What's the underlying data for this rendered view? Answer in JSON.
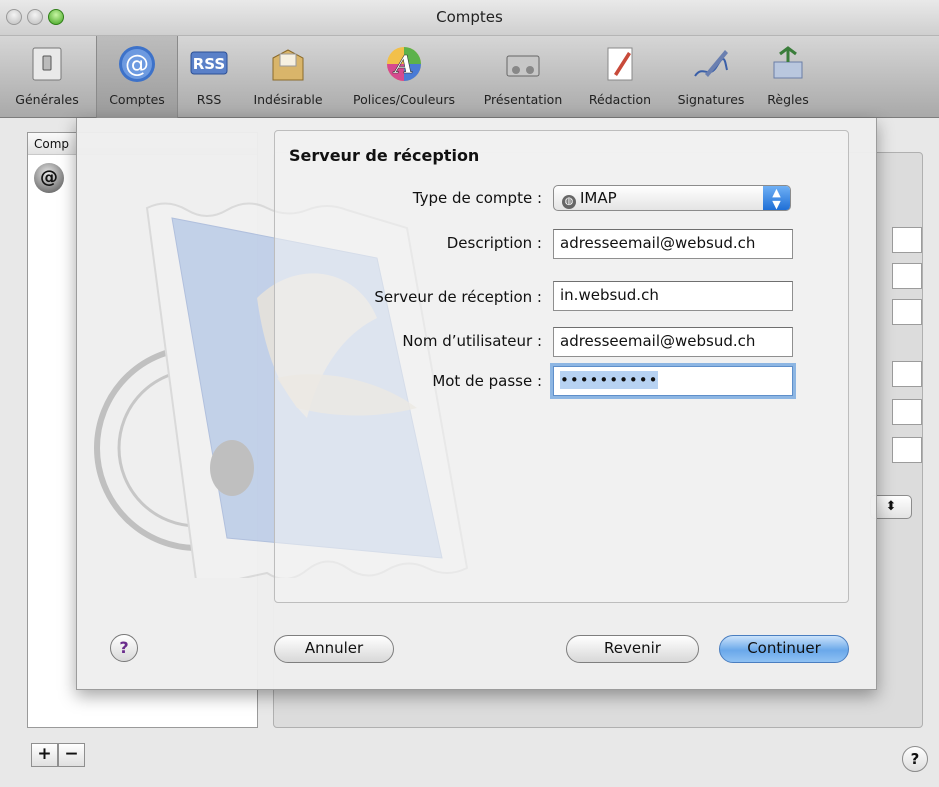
{
  "window": {
    "title": "Comptes"
  },
  "toolbar": {
    "items": [
      {
        "label": "Générales",
        "icon": "switch-icon"
      },
      {
        "label": "Comptes",
        "icon": "at-icon"
      },
      {
        "label": "RSS",
        "icon": "rss-icon"
      },
      {
        "label": "Indésirable",
        "icon": "junk-icon"
      },
      {
        "label": "Polices/Couleurs",
        "icon": "fonts-colors-icon"
      },
      {
        "label": "Présentation",
        "icon": "viewing-icon"
      },
      {
        "label": "Rédaction",
        "icon": "composing-icon"
      },
      {
        "label": "Signatures",
        "icon": "signatures-icon"
      },
      {
        "label": "Règles",
        "icon": "rules-icon"
      }
    ],
    "rss_badge": "RSS",
    "at_glyph": "@",
    "a_glyph": "A"
  },
  "accounts_list": {
    "header": "Comp",
    "icon_glyph": "@"
  },
  "sheet": {
    "title": "Serveur de réception",
    "account_type_label": "Type de compte :",
    "account_type_value": "IMAP",
    "description_label": "Description :",
    "description_value": "adresseemail@websud.ch",
    "incoming_server_label": "Serveur de réception :",
    "incoming_server_value": "in.websud.ch",
    "username_label": "Nom d’utilisateur :",
    "username_value": "adresseemail@websud.ch",
    "password_label": "Mot de passe :",
    "password_value": "••••••••••",
    "cancel_button": "Annuler",
    "back_button": "Revenir",
    "continue_button": "Continuer",
    "help_glyph": "?"
  },
  "bottom": {
    "plus": "+",
    "minus": "−",
    "help": "?"
  },
  "colors": {
    "default_button": "#6aa8ea",
    "focus_ring": "#8db6e3",
    "popup_arrows": "#1f6fd6"
  }
}
